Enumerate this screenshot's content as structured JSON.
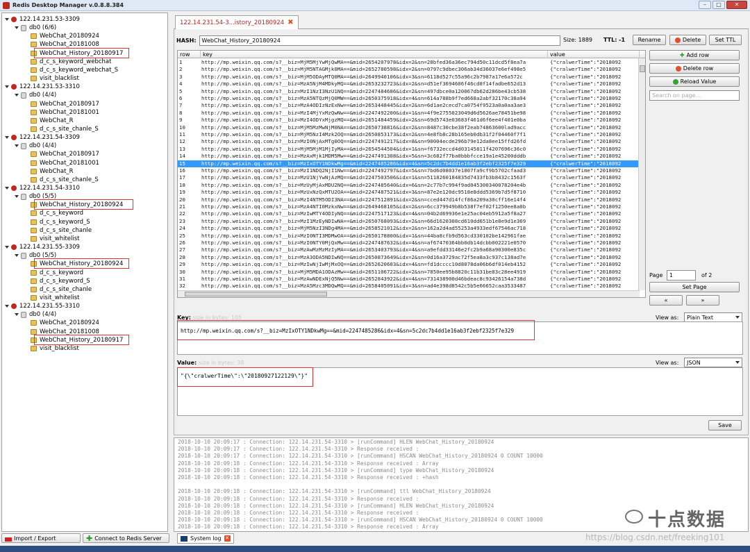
{
  "window": {
    "title": "Redis Desktop Manager v.0.8.8.384"
  },
  "tree": [
    {
      "kind": "server",
      "label": "122.14.231.53-3309",
      "depth": 0
    },
    {
      "kind": "db",
      "label": "db0  (6/6)",
      "depth": 1
    },
    {
      "kind": "key",
      "label": "WebChat_20180924",
      "depth": 2
    },
    {
      "kind": "key",
      "label": "WebChat_20181008",
      "depth": 2
    },
    {
      "kind": "key",
      "label": "WebChat_History_20180917",
      "depth": 2,
      "highlight": true
    },
    {
      "kind": "key",
      "label": "d_c_s_keyword_webchat",
      "depth": 2
    },
    {
      "kind": "key",
      "label": "d_c_s_keyword_webchat_S",
      "depth": 2
    },
    {
      "kind": "key",
      "label": "visit_blacklist",
      "depth": 2
    },
    {
      "kind": "server",
      "label": "122.14.231.53-3310",
      "depth": 0
    },
    {
      "kind": "db",
      "label": "db0  (4/4)",
      "depth": 1
    },
    {
      "kind": "key",
      "label": "WebChat_20180917",
      "depth": 2
    },
    {
      "kind": "key",
      "label": "WebChat_20181001",
      "depth": 2
    },
    {
      "kind": "key",
      "label": "WebChat_R",
      "depth": 2
    },
    {
      "kind": "key",
      "label": "d_c_s_site_chanle_S",
      "depth": 2
    },
    {
      "kind": "server",
      "label": "122.14.231.54-3309",
      "depth": 0
    },
    {
      "kind": "db",
      "label": "db0  (4/4)",
      "depth": 1
    },
    {
      "kind": "key",
      "label": "WebChat_20180917",
      "depth": 2
    },
    {
      "kind": "key",
      "label": "WebChat_20181001",
      "depth": 2
    },
    {
      "kind": "key",
      "label": "WebChat_R",
      "depth": 2
    },
    {
      "kind": "key",
      "label": "d_c_s_site_chanle_S",
      "depth": 2
    },
    {
      "kind": "server",
      "label": "122.14.231.54-3310",
      "depth": 0
    },
    {
      "kind": "db",
      "label": "db0  (5/5)",
      "depth": 1
    },
    {
      "kind": "key",
      "label": "WebChat_History_20180924",
      "depth": 2,
      "highlight": true,
      "selected": true
    },
    {
      "kind": "key",
      "label": "d_c_s_keyword",
      "depth": 2
    },
    {
      "kind": "key",
      "label": "d_c_s_keyword_S",
      "depth": 2
    },
    {
      "kind": "key",
      "label": "d_c_s_site_chanle",
      "depth": 2
    },
    {
      "kind": "key",
      "label": "visit_whitelist",
      "depth": 2
    },
    {
      "kind": "server",
      "label": "122.14.231.55-3309",
      "depth": 0
    },
    {
      "kind": "db",
      "label": "db0  (5/5)",
      "depth": 1
    },
    {
      "kind": "key",
      "label": "WebChat_History_20180924",
      "depth": 2,
      "highlight": true
    },
    {
      "kind": "key",
      "label": "d_c_s_keyword",
      "depth": 2
    },
    {
      "kind": "key",
      "label": "d_c_s_keyword_S",
      "depth": 2
    },
    {
      "kind": "key",
      "label": "d_c_s_site_chanle",
      "depth": 2
    },
    {
      "kind": "key",
      "label": "visit_whitelist",
      "depth": 2
    },
    {
      "kind": "server",
      "label": "122.14.231.55-3310",
      "depth": 0
    },
    {
      "kind": "db",
      "label": "db0  (4/4)",
      "depth": 1
    },
    {
      "kind": "key",
      "label": "WebChat_20180924",
      "depth": 2
    },
    {
      "kind": "key",
      "label": "WebChat_20181008",
      "depth": 2
    },
    {
      "kind": "key",
      "label": "WebChat_History_20180917",
      "depth": 2,
      "highlight": true
    },
    {
      "kind": "key",
      "label": "visit_blacklist",
      "depth": 2
    }
  ],
  "left_toolbar": {
    "import_export": "Import / Export",
    "connect": "Connect to Redis Server"
  },
  "tab": {
    "label": "122.14.231.54-3...istory_20180924"
  },
  "key_header": {
    "hash_label": "HASH:",
    "key_name": "WebChat_History_20180924",
    "size_label": "Size: 1889",
    "ttl_label": "TTL: -1",
    "rename": "Rename",
    "delete": "Delete",
    "set_ttl": "Set TTL"
  },
  "table": {
    "headers": [
      "row",
      "key",
      "value"
    ],
    "selected_row": 15,
    "rows": [
      [
        "1",
        "http://mp.weixin.qq.com/s?__biz=MjM5MjYwMjQwMA==&mid=2654207978&idx=2&sn=28bfed36a36ec794d50c11dcd5f8ea7a",
        "{\"cralwerTime\":\"2018092"
      ],
      [
        "2",
        "http://mp.weixin.qq.com/s?__biz=MjM5NTAGMjk0MA==&mid=2652780598&idx=2&sn=0797c9dbec306ab34d36037e6ef498e5",
        "{\"cralwerTime\":\"2018092"
      ],
      [
        "3",
        "http://mp.weixin.qq.com/s?__biz=MjM5ODAyMTQ0MA==&mid=2649940106&idx=3&sn=6118d527c55a96c2b7987a17e6a572c",
        "{\"cralwerTime\":\"2018092"
      ],
      [
        "4",
        "http://mp.weixin.qq.com/s?__biz=MzA5NjM4MDkyMQ==&mid=2653232723&idx=2&sn=d51ef3694606f46cd8f14fadbe652d13",
        "{\"cralwerTime\":\"2018092"
      ],
      [
        "5",
        "http://mp.weixin.qq.com/s?__biz=MzI1NzI3NzU1NQ==&mid=2247484686&idx=2&sn=497dbce0a120067db62d286be43cb538",
        "{\"cralwerTime\":\"2018092"
      ],
      [
        "6",
        "http://mp.weixin.qq.com/s?__biz=MzA5NTQzMjQ0MW==&mid=2650375918&idx=4&sn=614a788b9f7ed668a2abf32170c38a94",
        "{\"cralwerTime\":\"2018092"
      ],
      [
        "7",
        "http://mp.weixin.qq.com/s?__biz=MzA4ODIzNzExNw==&mid=2653448445&idx=2&sn=6d1ae2cecd7ca0754f9523a0a0aa3ae3",
        "{\"cralwerTime\":\"2018092"
      ],
      [
        "8",
        "http://mp.weixin.qq.com/s?__biz=MzI4MjYxMzQwNw==&mid=2247492200&idx=1&sn=4f9e2755023049d6d5626ae78451be98",
        "{\"cralwerTime\":\"2018092"
      ],
      [
        "9",
        "http://mp.weixin.qq.com/s?__biz=MzI4ODYxMjgzMQ==&mid=2651484459&idx=2&sn=69d5743e03683f461d6f6ee4f401e0ba",
        "{\"cralwerTime\":\"2018092"
      ],
      [
        "10",
        "http://mp.weixin.qq.com/s?__biz=MjM5MzMwNjM0NA==&mid=2650738816&idx=2&sn=8487c30cbe38f2eab74863600lad9acc",
        "{\"cralwerTime\":\"2018092"
      ],
      [
        "11",
        "http://mp.weixin.qq.com/s?__biz=MjM5NzI4Mzk2OQ==&mid=2650853173&idx=2&sn=4e8fb8c28b165eb0db31f2f04460f7f1",
        "{\"cralwerTime\":\"2018092"
      ],
      [
        "12",
        "http://mp.weixin.qq.com/s?__biz=MzI0NjAxMTg0OQ==&mid=2247491217&idx=8&sn=90004ecde296b79e12da8ee15ffd26fd",
        "{\"cralwerTime\":\"2018092"
      ],
      [
        "13",
        "http://mp.weixin.qq.com/s?__biz=MjM5MjM1MjIyMA==&mid=2654544504&idx=1&sn=f6732eccd4d03145811f4207696c36c0",
        "{\"cralwerTime\":\"2018092"
      ],
      [
        "14",
        "http://mp.weixin.qq.com/s?__biz=MzAxMjk1MDM5Mw==&mid=2247491308&idx=5&sn=3c682f77ba0bbbfcce19a1e45200dddb",
        "{\"cralwerTime\":\"2018092"
      ],
      [
        "15",
        "http://mp.weixin.qq.com/s?__biz=MzIxOTY1NDkwMg==&mid=2247485286&idx=4&sn=5c2dc7b4dd1e16ab3f2ebf2325f7e329",
        "{\"cralwerTime\":\"2018092"
      ],
      [
        "16",
        "http://mp.weixin.qq.com/s?__biz=MzI1NDQ2NjI1Nw==&mid=2247492797&idx=5&sn=7bd6d08037e1807fa9cf9b5702cfaad3",
        "{\"cralwerTime\":\"2018092"
      ],
      [
        "17",
        "http://mp.weixin.qq.com/s?__biz=MzU1NjYwNjAzMQ==&mid=2247503506&idx=1&sn=5118260184835d7433fb3b8432c1563f",
        "{\"cralwerTime\":\"2018092"
      ],
      [
        "18",
        "http://mp.weixin.qq.com/s?__biz=MzUyMjAxMDU2NQ==&mid=2247485640&idx=6&sn=2c77b7c994f9ad045300340078204e4b",
        "{\"cralwerTime\":\"2018092"
      ],
      [
        "19",
        "http://mp.weixin.qq.com/s?__biz=MzUxNzQxMTU2OA==&mid=2247487521&idx=3&sn=87e2e120dc9518e8ddd5369b7d5f8710",
        "{\"cralwerTime\":\"2018092"
      ],
      [
        "20",
        "http://mp.weixin.qq.com/s?__biz=MzI4NTM5ODI3NA==&mid=2247512891&idx=2&sn=cced447d14fcf86a209a30cff16e14f4",
        "{\"cralwerTime\":\"2018092"
      ],
      [
        "21",
        "http://mp.weixin.qq.com/s?__biz=MzA4NTI0MzkxNw==&mid=2649468105&idx=2&sn=6cc379949b8b538f7ef02f1250ee8a0b",
        "{\"cralwerTime\":\"2018092"
      ],
      [
        "22",
        "http://mp.weixin.qq.com/s?__biz=MzIwMTY4ODIyNQ==&mid=2247517123&idx=4&sn=04b2d69936e1e25ac04eb5912a5f8a27",
        "{\"cralwerTime\":\"2018092"
      ],
      [
        "23",
        "http://mp.weixin.qq.com/s?__biz=MzI1MzEyNDIwNA==&mid=2650768093&idx=2&sn=66d1620308cd610dd651b1e8e9d1e369",
        "{\"cralwerTime\":\"2018092"
      ],
      [
        "24",
        "http://mp.weixin.qq.com/s?__biz=MjM5NzI3NDg4MA==&mid=2658521012&idx=2&sn=162a2d4ad55253a4933edf67546ac718",
        "{\"cralwerTime\":\"2018092"
      ],
      [
        "25",
        "http://mp.weixin.qq.com/s?__biz=MzI0NTI3MDMwOA==&mid=2650178800&idx=1&sn=44ba8cfb9d563cd330102be142961fae",
        "{\"cralwerTime\":\"2018092"
      ],
      [
        "26",
        "http://mp.weixin.qq.com/s?__biz=MzI0NTY0MjQxMw==&mid=2247487632&idx=4&sn=af67470364bb0db14dcbb002221e0570",
        "{\"cralwerTime\":\"2018092"
      ],
      [
        "27",
        "http://mp.weixin.qq.com/s?__biz=MzAwMzMzMzIyMA==&mid=2653403793&idx=4&sn=a9efdd33146e2fc2b9a68a90300e835c",
        "{\"cralwerTime\":\"2018092"
      ],
      [
        "28",
        "http://mp.weixin.qq.com/s?__biz=MzA3ODA5NDIwNQ==&mid=2650873649&idx=2&sn=0d16a3729ac72f5ea8a3c937c138ad7e",
        "{\"cralwerTime\":\"2018092"
      ],
      [
        "29",
        "http://mp.weixin.qq.com/s?__biz=MzIwNjIwMjMxOQ==&mid=2652620603&idx=4&sn=fd1dcccc10d8078da06b6df014eb4152",
        "{\"cralwerTime\":\"2018092"
      ],
      [
        "30",
        "http://mp.weixin.qq.com/s?__biz=MjM5MDA1ODAzMw==&mid=2651106722&idx=2&sn=7850ee95b8820c11b31be83c28ee4919",
        "{\"cralwerTime\":\"2018092"
      ],
      [
        "31",
        "http://mp.weixin.qq.com/s?__biz=MzAwNDExNjQ5Nw==&mid=2652843922&idx=4&sn=731438900d46bdeac8c93426154a738d",
        "{\"cralwerTime\":\"2018092"
      ],
      [
        "32",
        "http://mp.weixin.qq.com/s?__biz=MzA5Mzc3MDQwMQ==&mid=2658405091&idx=3&sn=ad4e398d8542c5b5e66652caa3533487",
        "{\"cralwerTime\":\"2018092"
      ]
    ]
  },
  "side_buttons": {
    "add_row": "Add row",
    "delete_row": "Delete row",
    "reload_value": "Reload Value",
    "search_placeholder": "Search on page...",
    "page_label": "Page",
    "page_value": "1",
    "page_of": "of 2",
    "set_page": "Set Page",
    "prev": "«",
    "next": "»"
  },
  "key_section": {
    "label": "Key:",
    "hint": "size in bytes: 105",
    "view_as_label": "View as:",
    "view_as_value": "Plain Text",
    "value": "http://mp.weixin.qq.com/s?__biz=MzIxOTY1NDkwMg==&mid=2247485286&idx=4&sn=5c2dc7b4dd1e16ab3f2ebf2325f7e329"
  },
  "value_section": {
    "label": "Value:",
    "hint": "size in bytes: 38",
    "view_as_label": "View as:",
    "view_as_value": "JSON",
    "value": "\"{\\\"cralwerTime\\\":\\\"20180927122129\\\"}\"",
    "save": "Save"
  },
  "log": {
    "lines": [
      "2018-10-10 20:09:17 : Connection: 122.14.231.54-3310 > [runCommand] HLEN WebChat_History_20180924",
      "2018-10-10 20:09:17 : Connection: 122.14.231.54-3310 > Response received :",
      "2018-10-10 20:09:17 : Connection: 122.14.231.54-3310 > [runCommand] HSCAN WebChat_History_20180924 0 COUNT 10000",
      "2018-10-10 20:09:18 : Connection: 122.14.231.54-3310 > Response received : Array",
      "2018-10-10 20:09:18 : Connection: 122.14.231.54-3310 > [runCommand] type WebChat_History_20180924",
      "2018-10-10 20:09:18 : Connection: 122.14.231.54-3310 > Response received : +hash",
      "",
      "2018-10-10 20:09:18 : Connection: 122.14.231.54-3310 > [runCommand] ttl WebChat_History_20180924",
      "2018-10-10 20:09:18 : Connection: 122.14.231.54-3310 > Response received :",
      "2018-10-10 20:09:18 : Connection: 122.14.231.54-3310 > [runCommand] HLEN WebChat_History_20180924",
      "2018-10-10 20:09:18 : Connection: 122.14.231.54-3310 > Response received :",
      "2018-10-10 20:09:18 : Connection: 122.14.231.54-3310 > [runCommand] HSCAN WebChat_History_20180924 0 COUNT 10000",
      "2018-10-10 20:09:18 : Connection: 122.14.231.54-3310 > Response received : Array"
    ],
    "tab_label": "System log"
  },
  "watermark": {
    "brand": "十点数据",
    "url": "https://blog.csdn.net/freeking101"
  },
  "colors": {
    "selection": "#3399ff",
    "highlight_box": "#e03030",
    "tab_text": "#c02020"
  }
}
